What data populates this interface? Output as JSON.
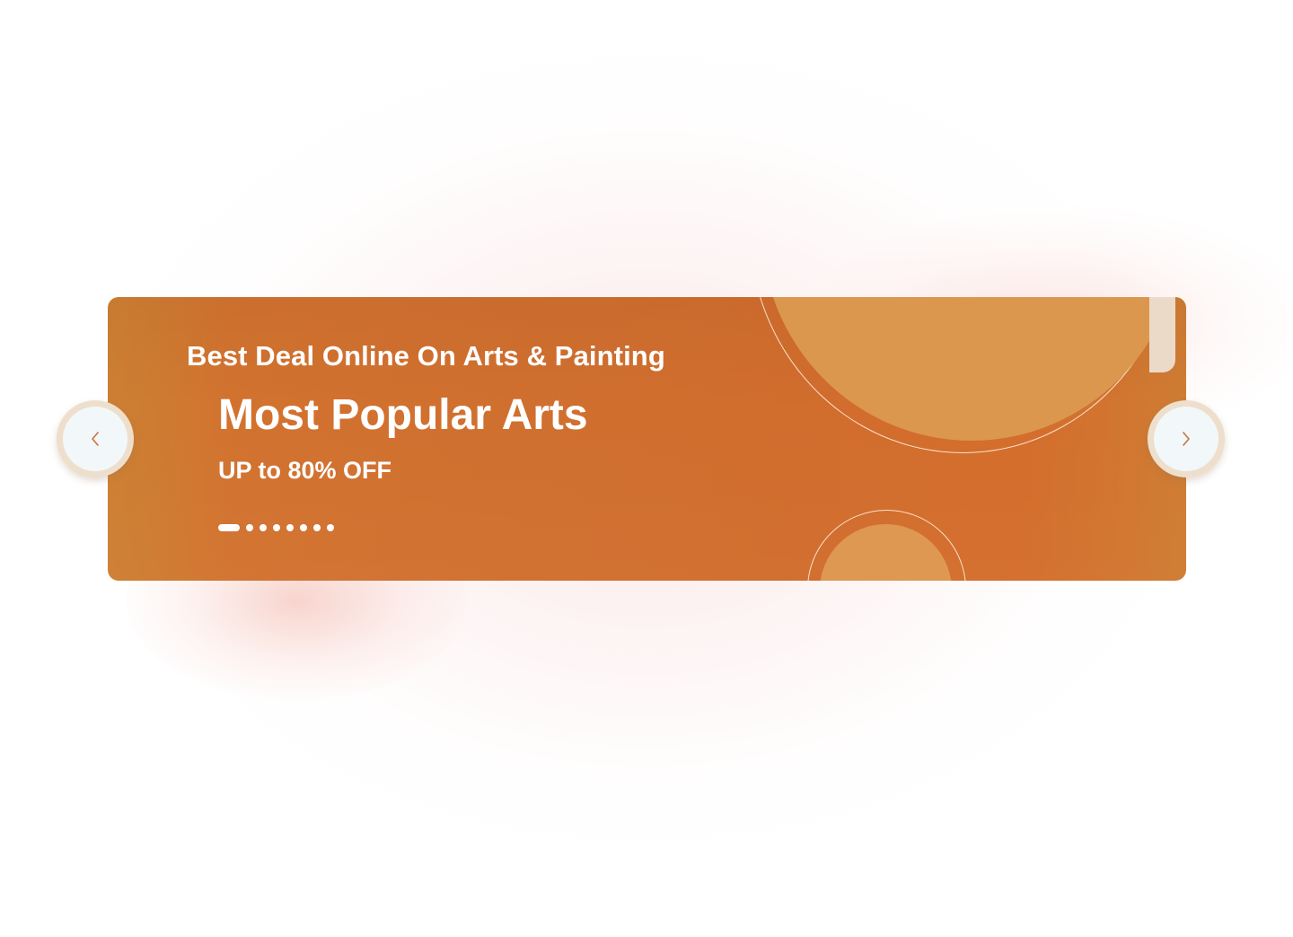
{
  "colors": {
    "banner_base": "#d16d2d",
    "banner_edge": "#cd8033",
    "decor_circle": "#dc974f",
    "decor_tab": "#ecdac9",
    "text": "#ffffff",
    "nav_ring": "#eedfcd",
    "nav_fill": "#f2f7fa",
    "chevron": "#c8743a"
  },
  "banner": {
    "subtitle": "Best Deal Online On Arts & Painting",
    "title": "Most Popular Arts",
    "discount": "UP to 80% OFF",
    "slides": {
      "total": 8,
      "active_index": 0
    }
  },
  "nav": {
    "prev_icon": "chevron-left-icon",
    "next_icon": "chevron-right-icon"
  }
}
